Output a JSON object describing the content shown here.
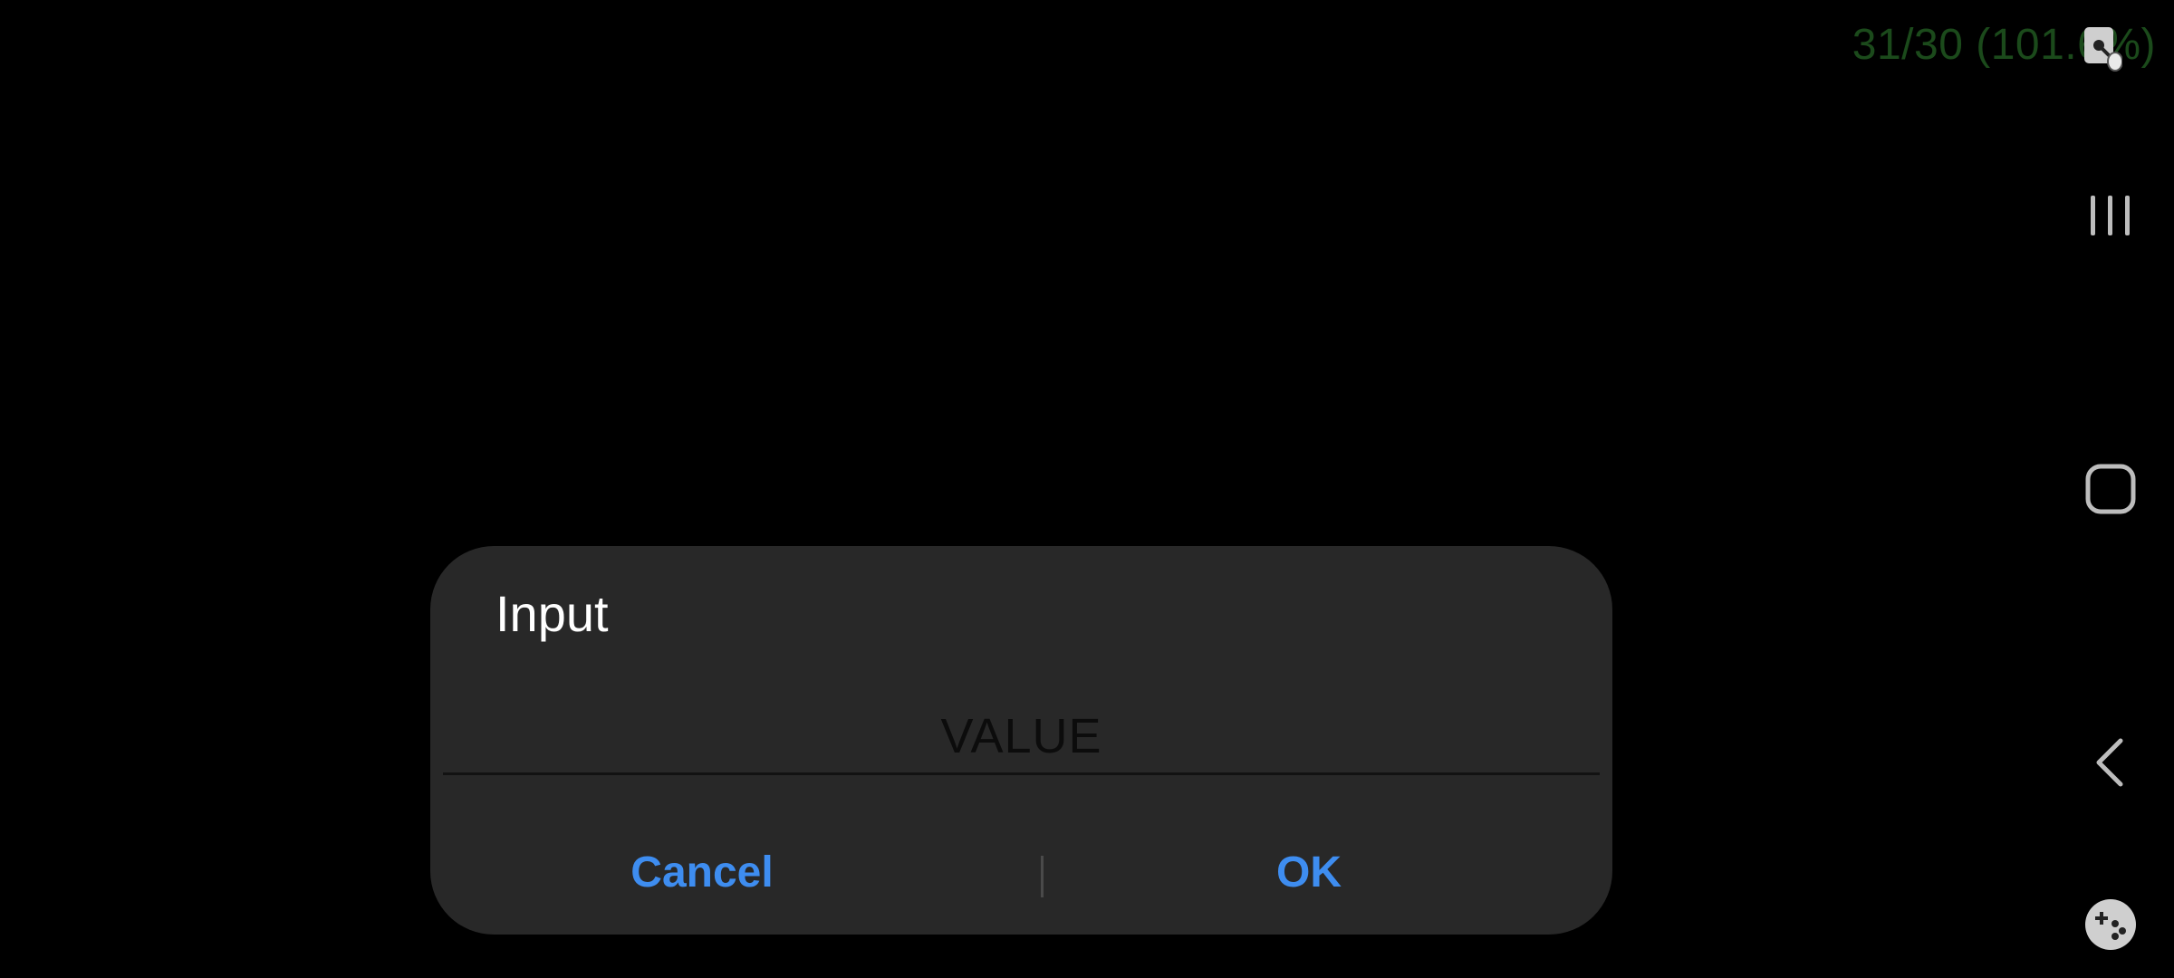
{
  "overlay": {
    "fps_counter": "31/30 (101.6%)",
    "screenshot_icon": "screenshot-hand-icon"
  },
  "navbar": {
    "recents_icon": "recents-icon",
    "home_icon": "home-icon",
    "back_icon": "back-icon",
    "game_tools_icon": "game-tools-icon"
  },
  "dialog": {
    "title": "Input",
    "input_value": "VALUE",
    "cancel_label": "Cancel",
    "ok_label": "OK"
  },
  "colors": {
    "background": "#000000",
    "dialog_background": "#282828",
    "accent": "#3e8df0",
    "fps_text": "#1b4a1b"
  }
}
